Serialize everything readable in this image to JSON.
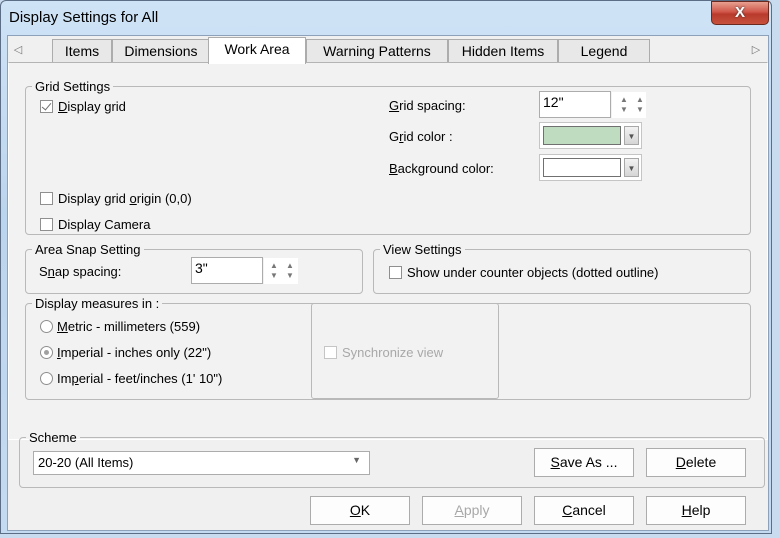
{
  "window": {
    "title": "Display Settings for All",
    "close_glyph": "X"
  },
  "tabs": {
    "scroll_left_glyph": "◁",
    "scroll_right_glyph": "▷",
    "items": [
      {
        "label": "Items",
        "active": false
      },
      {
        "label": "Dimensions",
        "active": false
      },
      {
        "label": "Work Area",
        "active": true
      },
      {
        "label": "Warning Patterns",
        "active": false
      },
      {
        "label": "Hidden Items",
        "active": false
      },
      {
        "label": "Legend",
        "active": false
      }
    ]
  },
  "grid_settings": {
    "legend": "Grid Settings",
    "display_grid": {
      "label_pre": "",
      "label_u": "D",
      "label_post": "isplay grid",
      "checked": true
    },
    "display_grid_origin": {
      "label_pre": "Display grid ",
      "label_u": "o",
      "label_post": "rigin (0,0)",
      "checked": false
    },
    "display_camera": {
      "label": "Display Camera",
      "checked": false
    },
    "grid_spacing": {
      "label_u": "G",
      "label_post": "rid spacing:",
      "value": "12\""
    },
    "grid_color": {
      "label_pre": "G",
      "label_u": "r",
      "label_post": "id color :",
      "color": "#c0dcc0"
    },
    "background_color": {
      "label_u": "B",
      "label_post": "ackground color:",
      "color": "#ffffff"
    }
  },
  "area_snap": {
    "legend": "Area Snap Setting",
    "snap_spacing": {
      "label_pre": "S",
      "label_u": "n",
      "label_post": "ap spacing:",
      "value": "3\""
    }
  },
  "view_settings": {
    "legend": "View Settings",
    "show_under_counter": {
      "label": "Show under counter objects (dotted outline)",
      "checked": false
    }
  },
  "measures": {
    "legend": "Display measures in :",
    "options": [
      {
        "label_pre": "",
        "label_u": "M",
        "label_post": "etric - millimeters (559)",
        "selected": false
      },
      {
        "label_pre": "",
        "label_u": "I",
        "label_post": "mperial - inches only (22\")",
        "selected": true
      },
      {
        "label_pre": "Im",
        "label_u": "p",
        "label_post": "erial - feet/inches (1' 10\")",
        "selected": false
      }
    ],
    "synchronize_view": {
      "label": "Synchronize view",
      "checked": false,
      "enabled": false
    }
  },
  "scheme": {
    "legend": "Scheme",
    "selected": "20-20 (All Items)",
    "save_as": {
      "u": "S",
      "rest": "ave As ..."
    },
    "delete": {
      "u": "D",
      "rest": "elete"
    }
  },
  "footer": {
    "ok": {
      "u": "O",
      "rest": "K"
    },
    "apply": {
      "u": "A",
      "rest": "pply",
      "enabled": false
    },
    "cancel": {
      "u": "C",
      "rest": "ancel"
    },
    "help": {
      "u": "H",
      "rest": "elp"
    }
  }
}
